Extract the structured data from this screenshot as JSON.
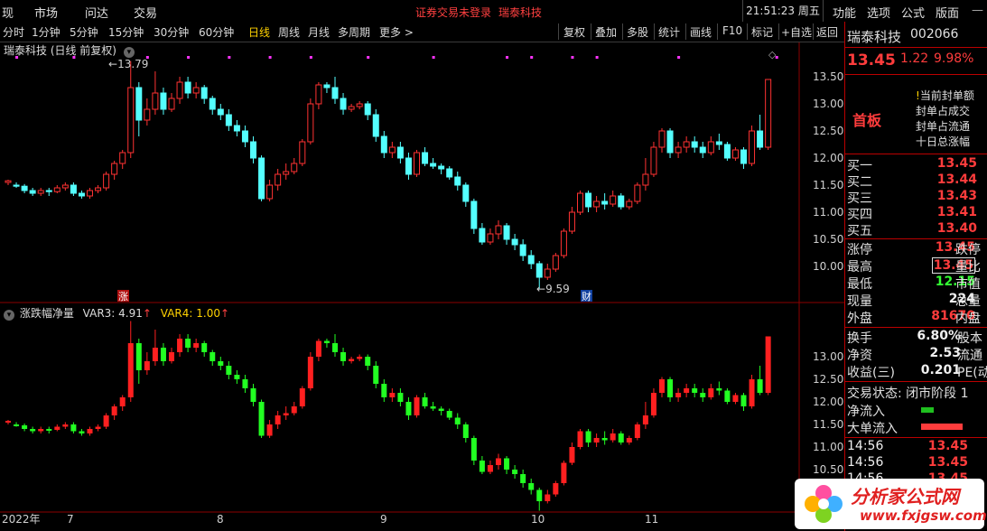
{
  "menubar": {
    "left_items": [
      "现",
      "市场",
      "问达",
      "交易"
    ],
    "notice_login": "证券交易未登录",
    "notice_stock": "瑞泰科技",
    "clock": "21:51:23 周五",
    "right_items": [
      "功能",
      "选项",
      "公式",
      "版面"
    ]
  },
  "toolbar": {
    "periods": [
      "分时",
      "1分钟",
      "5分钟",
      "15分钟",
      "30分钟",
      "60分钟",
      "日线",
      "周线",
      "月线",
      "多周期",
      "更多 >"
    ],
    "active_period": "日线",
    "tools": [
      "复权",
      "叠加",
      "多股",
      "统计",
      "画线",
      "F10",
      "标记",
      "+自选",
      "返回"
    ]
  },
  "main_chart": {
    "title": "瑞泰科技 (日线 前复权)",
    "high_label": "13.79",
    "low_label": "9.59",
    "marker_zhang": "涨",
    "marker_cai": "财",
    "y_ticks": [
      "13.50",
      "13.00",
      "12.50",
      "12.00",
      "11.50",
      "11.00",
      "10.50",
      "10.00"
    ]
  },
  "sub_chart": {
    "title": "涨跌幅净量",
    "var3_label": "VAR3: 4.91",
    "var4_label": "VAR4: 1.00",
    "y_ticks": [
      "13.00",
      "12.50",
      "12.00",
      "11.50",
      "11.00",
      "10.50"
    ]
  },
  "x_axis": [
    "2022年",
    "7",
    "8",
    "9",
    "10",
    "11"
  ],
  "panel": {
    "name": "瑞泰科技",
    "code": "002066",
    "price": "13.45",
    "change": "1.22",
    "pct": "9.98%",
    "tag": "首板",
    "info": [
      "当前封单额",
      "封单占成交",
      "封单占流通",
      "十日总涨幅"
    ],
    "bids": [
      {
        "label": "买一",
        "value": "13.45"
      },
      {
        "label": "买二",
        "value": "13.44"
      },
      {
        "label": "买三",
        "value": "13.43"
      },
      {
        "label": "买四",
        "value": "13.41"
      },
      {
        "label": "买五",
        "value": "13.40"
      }
    ],
    "stats": [
      {
        "label": "涨停",
        "value": "13.45",
        "ext": "跌停"
      },
      {
        "label": "最高",
        "value": "13.45",
        "ext": "量比"
      },
      {
        "label": "最低",
        "value": "12.15",
        "ext": "市值"
      },
      {
        "label": "现量",
        "value": "224",
        "ext": "总量"
      },
      {
        "label": "外盘",
        "value": "81670",
        "ext": "内盘"
      }
    ],
    "stats2": [
      {
        "label": "换手",
        "value": "6.80%",
        "ext": "股本"
      },
      {
        "label": "净资",
        "value": "2.53",
        "ext": "流通"
      },
      {
        "label": "收益(三)",
        "value": "0.201",
        "ext": "PE(动"
      }
    ],
    "trade_status": "交易状态: 闭市阶段 1",
    "net_inflow": "净流入",
    "big_inflow": "大单流入",
    "ticks": [
      {
        "time": "14:56",
        "price": "13.45"
      },
      {
        "time": "14:56",
        "price": "13.45"
      },
      {
        "time": "14:56",
        "price": "13.45"
      }
    ]
  },
  "logo": {
    "text": "分析家公式网",
    "url": "www.fxjgsw.com"
  },
  "chart_data": {
    "type": "candlestick",
    "title": "瑞泰科技 (日线 前复权)",
    "ylim": [
      9.4,
      13.8
    ],
    "candles": [
      [
        11.55,
        11.58,
        11.5,
        11.6
      ],
      [
        11.5,
        11.48,
        11.45,
        11.55
      ],
      [
        11.48,
        11.4,
        11.35,
        11.52
      ],
      [
        11.4,
        11.35,
        11.3,
        11.45
      ],
      [
        11.35,
        11.4,
        11.3,
        11.45
      ],
      [
        11.4,
        11.38,
        11.3,
        11.45
      ],
      [
        11.38,
        11.45,
        11.35,
        11.5
      ],
      [
        11.45,
        11.5,
        11.4,
        11.55
      ],
      [
        11.5,
        11.35,
        11.3,
        11.55
      ],
      [
        11.35,
        11.3,
        11.25,
        11.4
      ],
      [
        11.3,
        11.4,
        11.25,
        11.45
      ],
      [
        11.4,
        11.45,
        11.35,
        11.5
      ],
      [
        11.45,
        11.7,
        11.4,
        11.75
      ],
      [
        11.7,
        11.9,
        11.6,
        11.95
      ],
      [
        11.9,
        12.1,
        11.8,
        12.15
      ],
      [
        12.1,
        13.3,
        12.0,
        13.79
      ],
      [
        13.3,
        12.7,
        12.4,
        13.4
      ],
      [
        12.7,
        12.9,
        12.6,
        13.1
      ],
      [
        12.9,
        13.2,
        12.8,
        13.6
      ],
      [
        13.2,
        12.9,
        12.8,
        13.3
      ],
      [
        12.9,
        13.1,
        12.85,
        13.2
      ],
      [
        13.1,
        13.4,
        13.0,
        13.5
      ],
      [
        13.4,
        13.2,
        13.1,
        13.5
      ],
      [
        13.2,
        13.3,
        13.1,
        13.4
      ],
      [
        13.3,
        13.1,
        13.0,
        13.35
      ],
      [
        13.1,
        12.9,
        12.8,
        13.15
      ],
      [
        12.9,
        12.8,
        12.7,
        13.0
      ],
      [
        12.8,
        12.6,
        12.5,
        12.9
      ],
      [
        12.6,
        12.5,
        12.4,
        12.7
      ],
      [
        12.5,
        12.3,
        12.2,
        12.6
      ],
      [
        12.3,
        12.0,
        11.9,
        12.4
      ],
      [
        12.0,
        11.25,
        11.2,
        12.05
      ],
      [
        11.25,
        11.5,
        11.2,
        11.6
      ],
      [
        11.5,
        11.7,
        11.4,
        11.8
      ],
      [
        11.7,
        11.75,
        11.6,
        11.9
      ],
      [
        11.75,
        11.9,
        11.7,
        12.0
      ],
      [
        11.9,
        12.3,
        11.85,
        12.35
      ],
      [
        12.3,
        13.0,
        12.25,
        13.1
      ],
      [
        13.0,
        13.35,
        12.9,
        13.4
      ],
      [
        13.35,
        13.3,
        13.2,
        13.4
      ],
      [
        13.3,
        13.1,
        13.0,
        13.5
      ],
      [
        13.1,
        12.9,
        12.8,
        13.2
      ],
      [
        12.9,
        12.95,
        12.85,
        13.0
      ],
      [
        12.95,
        13.0,
        12.9,
        13.05
      ],
      [
        13.0,
        12.8,
        12.7,
        13.05
      ],
      [
        12.8,
        12.4,
        12.3,
        12.9
      ],
      [
        12.4,
        12.1,
        12.0,
        12.5
      ],
      [
        12.1,
        12.2,
        12.0,
        12.3
      ],
      [
        12.2,
        12.0,
        11.9,
        12.3
      ],
      [
        12.0,
        11.7,
        11.6,
        12.1
      ],
      [
        11.7,
        12.1,
        11.65,
        12.15
      ],
      [
        12.1,
        11.9,
        11.85,
        12.2
      ],
      [
        11.9,
        11.85,
        11.8,
        12.0
      ],
      [
        11.85,
        11.8,
        11.7,
        11.9
      ],
      [
        11.8,
        11.65,
        11.6,
        11.85
      ],
      [
        11.65,
        11.5,
        11.4,
        11.75
      ],
      [
        11.5,
        11.2,
        11.1,
        11.55
      ],
      [
        11.2,
        10.7,
        10.6,
        11.25
      ],
      [
        10.7,
        10.45,
        10.4,
        10.8
      ],
      [
        10.45,
        10.6,
        10.4,
        10.7
      ],
      [
        10.6,
        10.75,
        10.5,
        10.85
      ],
      [
        10.75,
        10.5,
        10.4,
        10.8
      ],
      [
        10.5,
        10.4,
        10.3,
        10.6
      ],
      [
        10.4,
        10.2,
        10.1,
        10.5
      ],
      [
        10.2,
        10.05,
        9.95,
        10.3
      ],
      [
        10.05,
        9.8,
        9.59,
        10.1
      ],
      [
        9.8,
        9.95,
        9.75,
        10.05
      ],
      [
        9.95,
        10.2,
        9.9,
        10.25
      ],
      [
        10.2,
        10.65,
        10.15,
        10.7
      ],
      [
        10.65,
        11.0,
        10.6,
        11.1
      ],
      [
        11.0,
        11.35,
        10.95,
        11.4
      ],
      [
        11.35,
        11.1,
        11.0,
        11.4
      ],
      [
        11.1,
        11.2,
        11.0,
        11.3
      ],
      [
        11.2,
        11.15,
        11.05,
        11.35
      ],
      [
        11.15,
        11.3,
        11.1,
        11.4
      ],
      [
        11.3,
        11.1,
        11.05,
        11.35
      ],
      [
        11.1,
        11.2,
        11.05,
        11.25
      ],
      [
        11.2,
        11.5,
        11.15,
        11.55
      ],
      [
        11.5,
        11.7,
        11.4,
        12.0
      ],
      [
        11.7,
        12.2,
        11.65,
        12.3
      ],
      [
        12.2,
        12.5,
        12.1,
        12.55
      ],
      [
        12.5,
        12.1,
        12.0,
        12.55
      ],
      [
        12.1,
        12.2,
        12.0,
        12.3
      ],
      [
        12.2,
        12.3,
        12.1,
        12.4
      ],
      [
        12.3,
        12.2,
        12.1,
        12.4
      ],
      [
        12.2,
        12.1,
        12.0,
        12.3
      ],
      [
        12.1,
        12.3,
        12.05,
        12.4
      ],
      [
        12.3,
        12.25,
        12.15,
        12.45
      ],
      [
        12.25,
        12.0,
        11.95,
        12.3
      ],
      [
        12.0,
        12.15,
        11.95,
        12.2
      ],
      [
        12.15,
        11.9,
        11.8,
        12.2
      ],
      [
        11.9,
        12.5,
        11.85,
        12.6
      ],
      [
        12.5,
        12.2,
        12.15,
        12.8
      ],
      [
        12.2,
        13.45,
        12.15,
        13.45
      ]
    ]
  }
}
